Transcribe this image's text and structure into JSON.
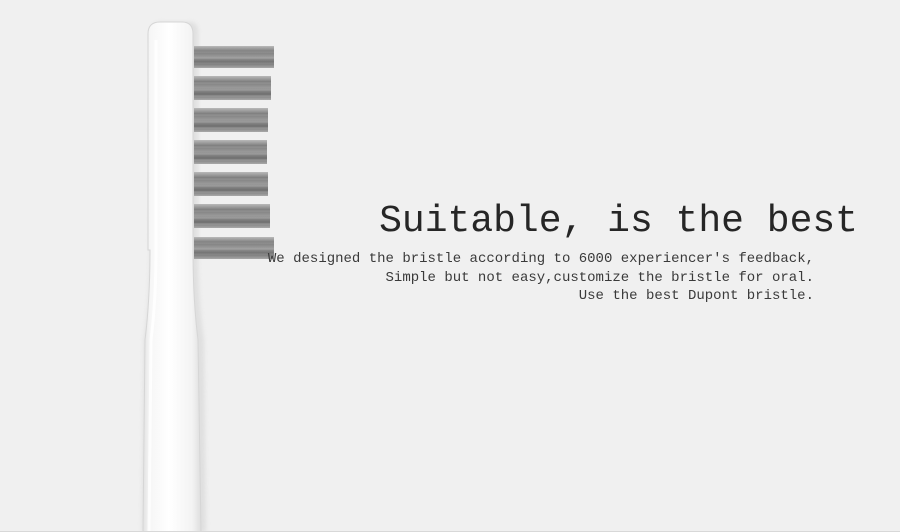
{
  "headline": "Suitable, is the best",
  "copy": {
    "line1": "We designed the bristle according to 6000 experiencer's feedback,",
    "line2": "Simple but not easy,customize the bristle for oral.",
    "line3": "Use the best Dupont bristle."
  },
  "colors": {
    "background": "#f0f0f0",
    "handle": "#fbfbfb",
    "bristle": "#8a8a8a",
    "text": "#262626"
  },
  "bristle_row_count": 7
}
